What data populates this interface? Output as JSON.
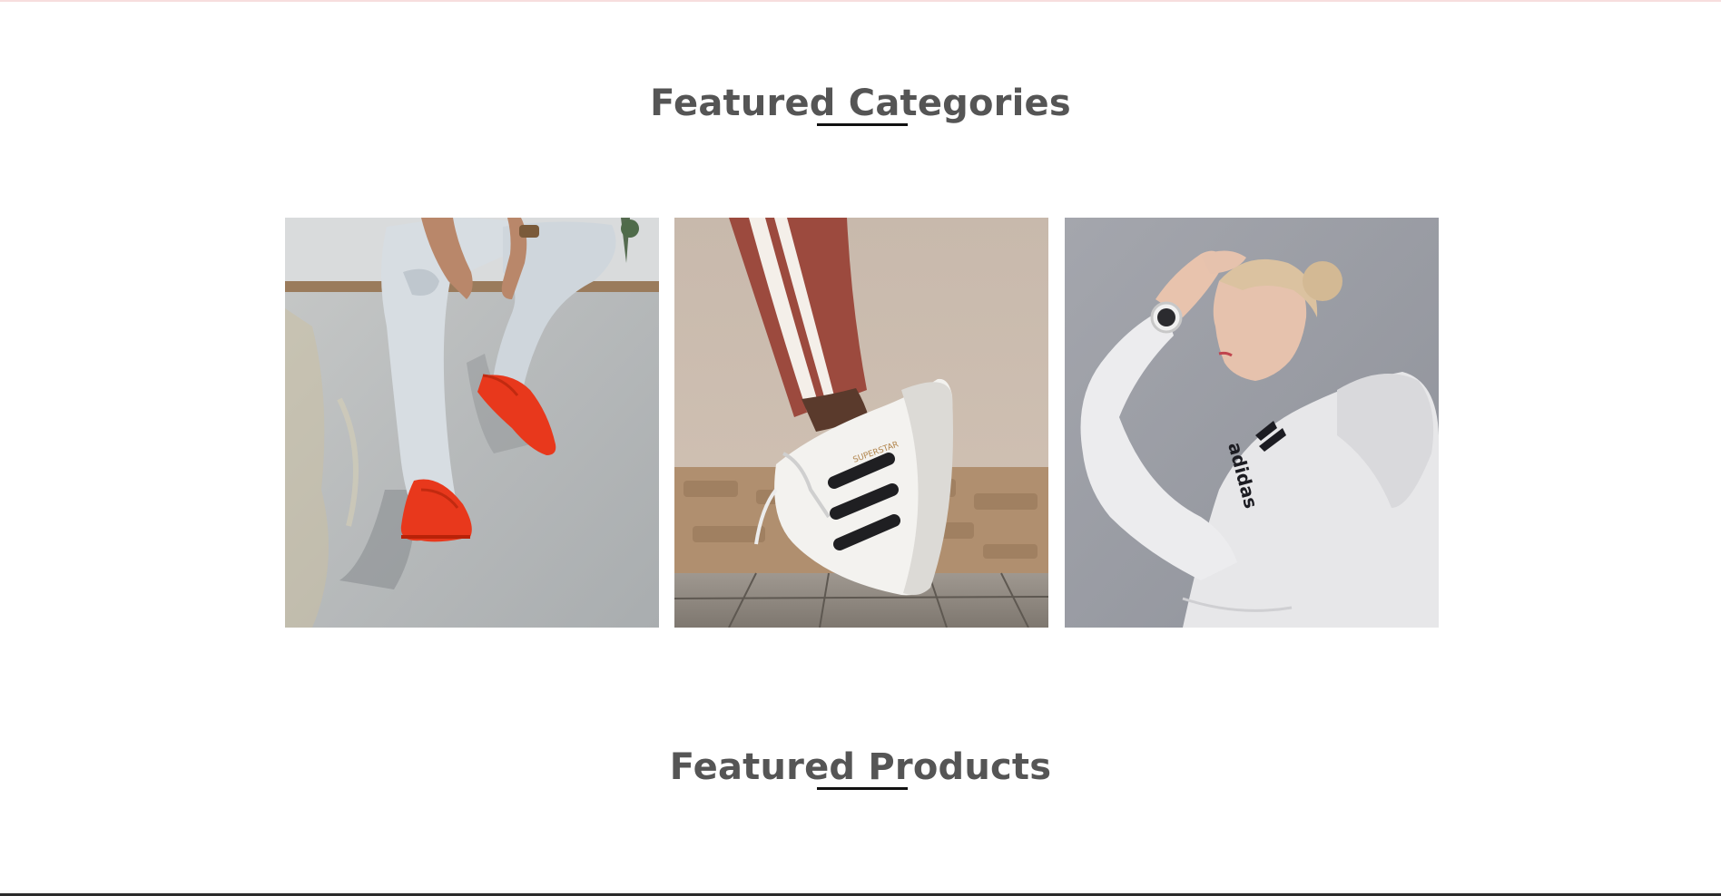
{
  "featured_categories": {
    "title": "Featured Categories",
    "cards": [
      {
        "icon": "red-sneakers-photo"
      },
      {
        "icon": "superstar-sneaker-photo"
      },
      {
        "icon": "white-hoodie-athlete-photo"
      }
    ]
  },
  "featured_products": {
    "title": "Featured Products"
  },
  "colors": {
    "heading": "#555555",
    "underline": "#111111",
    "accent_red": "#e8381c"
  }
}
